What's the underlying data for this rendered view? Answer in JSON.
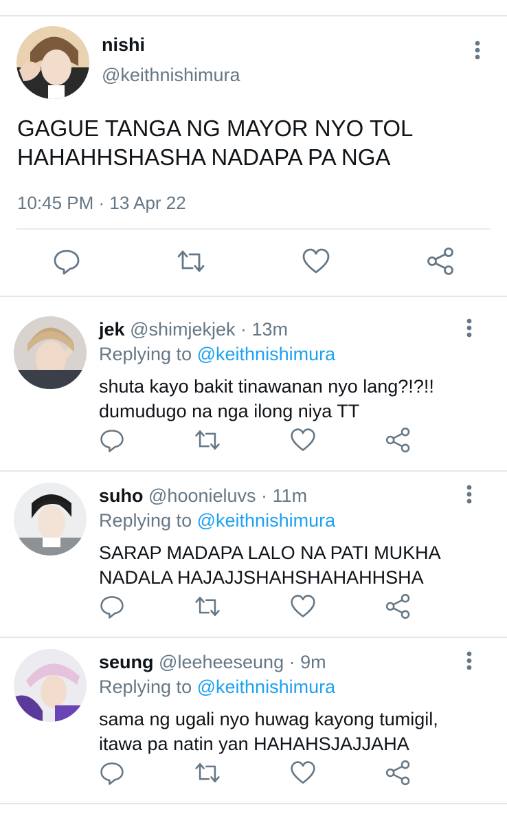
{
  "main": {
    "name": "nishi",
    "handle": "@keithnishimura",
    "text": "GAGUE TANGA NG MAYOR NYO TOL HAHAHHSHASHA NADAPA PA NGA",
    "timestamp": "10:45 PM · 13 Apr 22"
  },
  "replies": [
    {
      "name": "jek",
      "handle": "@shimjekjek",
      "age": "· 13m",
      "replying_label": "Replying to",
      "replying_to": "@keithnishimura",
      "text": "shuta kayo bakit tinawanan nyo lang?!?!! dumudugo na nga ilong niya TT"
    },
    {
      "name": "suho",
      "handle": "@hoonieluvs",
      "age": "· 11m",
      "replying_label": "Replying to",
      "replying_to": "@keithnishimura",
      "text": "SARAP MADAPA LALO NA PATI MUKHA NADALA HAJAJJSHAHSHAHAHHSHA"
    },
    {
      "name": "seung",
      "handle": "@leeheeseung",
      "age": "· 9m",
      "replying_label": "Replying to",
      "replying_to": "@keithnishimura",
      "text": "sama ng ugali nyo huwag kayong tumigil, itawa pa natin yan HAHAHSJAJJAHA"
    }
  ],
  "icons": {
    "reply": "reply-icon",
    "retweet": "retweet-icon",
    "like": "heart-icon",
    "share": "share-icon",
    "more": "more-vertical-icon"
  },
  "colors": {
    "text": "#0f1419",
    "secondary": "#657786",
    "link": "#1da1f2",
    "divider": "#e1e8ed"
  }
}
